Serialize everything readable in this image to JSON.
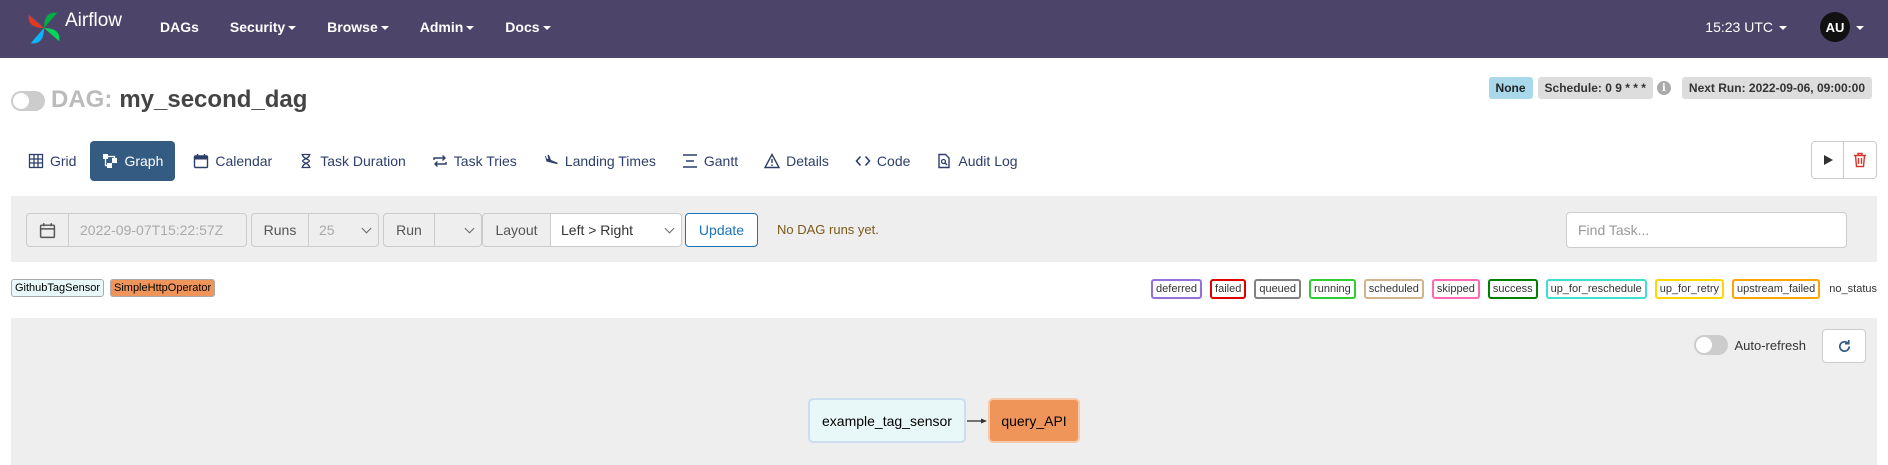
{
  "navbar": {
    "brand": "Airflow",
    "menu": [
      {
        "label": "DAGs",
        "has_caret": false
      },
      {
        "label": "Security",
        "has_caret": true
      },
      {
        "label": "Browse",
        "has_caret": true
      },
      {
        "label": "Admin",
        "has_caret": true
      },
      {
        "label": "Docs",
        "has_caret": true
      }
    ],
    "time": "15:23 UTC",
    "user_initials": "AU"
  },
  "dag": {
    "prefix": "DAG:",
    "name": "my_second_dag",
    "paused": true,
    "badge_none": "None",
    "schedule": "Schedule: 0 9 * * *",
    "info_icon": "i",
    "next_run": "Next Run: 2022-09-06, 09:00:00"
  },
  "tabs": [
    {
      "label": "Grid",
      "icon": "grid-icon"
    },
    {
      "label": "Graph",
      "icon": "graph-icon",
      "active": true
    },
    {
      "label": "Calendar",
      "icon": "calendar-icon"
    },
    {
      "label": "Task Duration",
      "icon": "hourglass-icon"
    },
    {
      "label": "Task Tries",
      "icon": "retry-icon"
    },
    {
      "label": "Landing Times",
      "icon": "plane-landing-icon"
    },
    {
      "label": "Gantt",
      "icon": "gantt-icon"
    },
    {
      "label": "Details",
      "icon": "warning-triangle-icon"
    },
    {
      "label": "Code",
      "icon": "code-icon"
    },
    {
      "label": "Audit Log",
      "icon": "file-search-icon"
    }
  ],
  "filters": {
    "date_value": "2022-09-07T15:22:57Z",
    "runs_label": "Runs",
    "runs_value": "25",
    "run_label": "Run",
    "run_value": "",
    "layout_label": "Layout",
    "layout_value": "Left > Right",
    "update_label": "Update",
    "status_message": "No DAG runs yet.",
    "find_task_placeholder": "Find Task..."
  },
  "operator_legend": [
    {
      "label": "GithubTagSensor",
      "color": "#e8f7f7"
    },
    {
      "label": "SimpleHttpOperator",
      "color": "#f0955a"
    }
  ],
  "state_legend": [
    {
      "label": "deferred",
      "color": "#9370db"
    },
    {
      "label": "failed",
      "color": "#e00000"
    },
    {
      "label": "queued",
      "color": "#808080"
    },
    {
      "label": "running",
      "color": "#32cd32"
    },
    {
      "label": "scheduled",
      "color": "#d2b48c"
    },
    {
      "label": "skipped",
      "color": "#ff69b4"
    },
    {
      "label": "success",
      "color": "#008000"
    },
    {
      "label": "up_for_reschedule",
      "color": "#40e0d0"
    },
    {
      "label": "up_for_retry",
      "color": "#ffd700"
    },
    {
      "label": "upstream_failed",
      "color": "#ffa500"
    },
    {
      "label": "no_status",
      "color": ""
    }
  ],
  "graph": {
    "auto_refresh_label": "Auto-refresh",
    "nodes": [
      {
        "id": "example_tag_sensor",
        "color": "#e8f7f7"
      },
      {
        "id": "query_API",
        "color": "#f0955a"
      }
    ]
  }
}
